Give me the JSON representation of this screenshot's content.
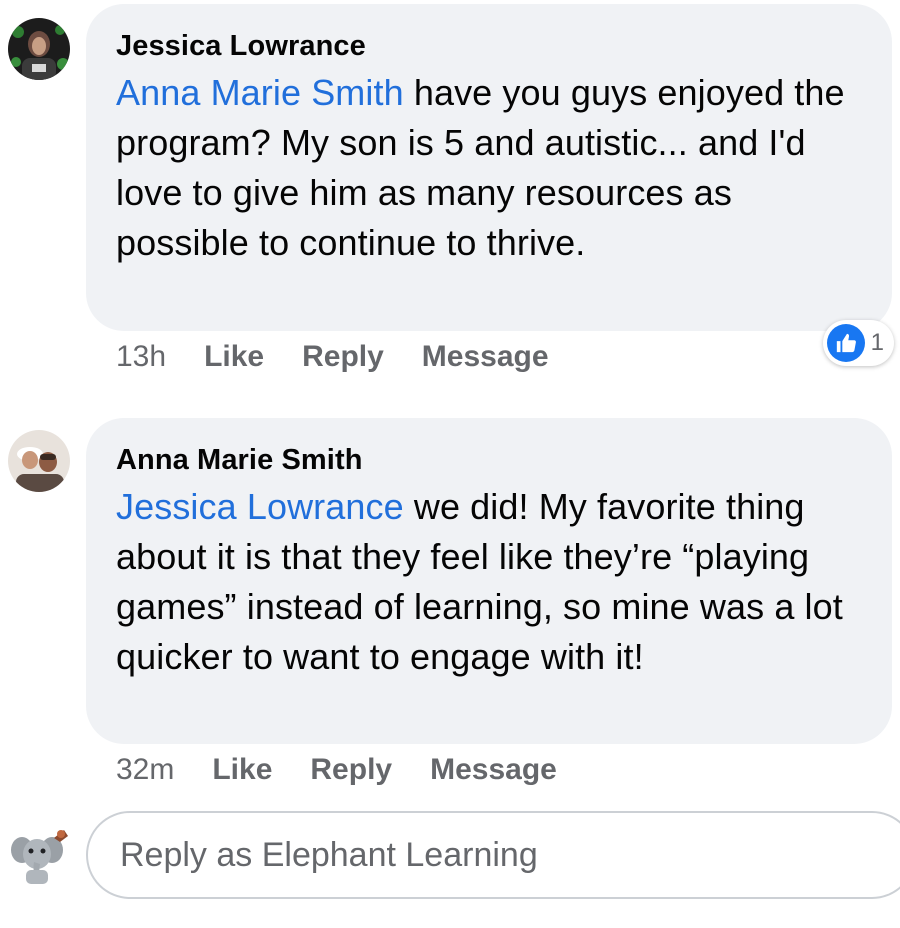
{
  "comments": [
    {
      "author": "Jessica Lowrance",
      "mention": "Anna Marie Smith",
      "text": " have you guys enjoyed the program? My son is 5 and autistic... and I'd love to give him as many resources as possible to continue to thrive.",
      "time": "13h",
      "like_label": "Like",
      "reply_label": "Reply",
      "message_label": "Message",
      "reaction_count": "1",
      "reaction_icon": "like-thumb-icon",
      "avatar_icon": "profile-photo-jessica"
    },
    {
      "author": "Anna Marie Smith",
      "mention": "Jessica Lowrance",
      "text": " we did! My favorite thing about it is that they feel like they’re “playing games” instead of learning, so mine was a lot quicker to want to engage with it!",
      "time": "32m",
      "like_label": "Like",
      "reply_label": "Reply",
      "message_label": "Message",
      "avatar_icon": "profile-photo-anna"
    }
  ],
  "reply_box": {
    "placeholder": "Reply as Elephant Learning",
    "avatar_icon": "elephant-learning-page-avatar"
  },
  "colors": {
    "mention": "#216fdb",
    "bubble": "#f0f2f5",
    "like_badge": "#1877f2",
    "meta_text": "#65676b"
  }
}
